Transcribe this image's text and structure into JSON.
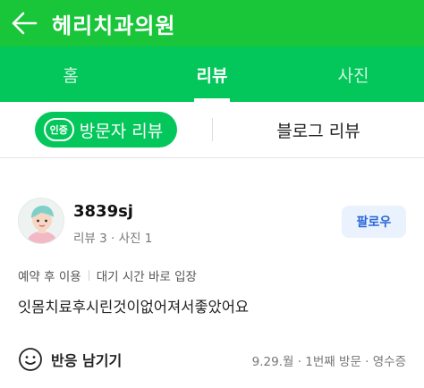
{
  "header": {
    "title": "헤리치과의원"
  },
  "tabs": [
    {
      "label": "홈"
    },
    {
      "label": "리뷰"
    },
    {
      "label": "사진"
    }
  ],
  "subtabs": {
    "badge": "인증",
    "visitor_review": "방문자 리뷰",
    "blog_review": "블로그 리뷰"
  },
  "review": {
    "username": "3839sj",
    "stats": "리뷰 3 · 사진 1",
    "follow_label": "팔로우",
    "tags": [
      "예약 후 이용",
      "대기 시간 바로 입장"
    ],
    "text": "잇몸치료후시린것이없어져서좋았어요",
    "react_label": "반응 남기기",
    "visit_info": "9.29.월 · 1번째 방문 · 영수증"
  },
  "colors": {
    "header_bg": "#19c639",
    "tab_bg": "#03c75a",
    "follow_text": "#2a67d8",
    "follow_bg": "#eaf2fe"
  },
  "icons": [
    "back-arrow-icon",
    "certified-badge-icon",
    "avatar-illustration",
    "smile-icon"
  ]
}
